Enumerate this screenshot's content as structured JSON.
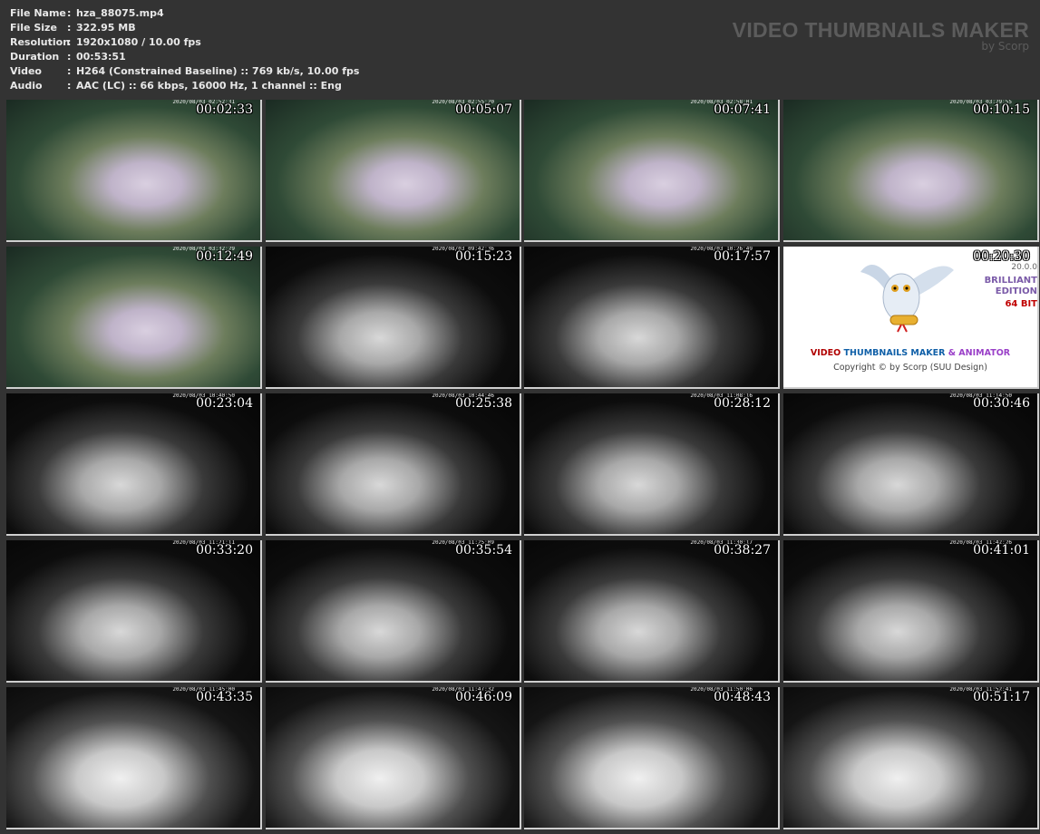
{
  "info": [
    {
      "label": "File Name",
      "value": "hza_88075.mp4"
    },
    {
      "label": "File Size",
      "value": "322.95 MB"
    },
    {
      "label": "Resolution",
      "value": "1920x1080 / 10.00 fps"
    },
    {
      "label": "Duration",
      "value": "00:53:51"
    },
    {
      "label": "Video",
      "value": "H264 (Constrained Baseline) :: 769 kb/s, 10.00 fps"
    },
    {
      "label": "Audio",
      "value": "AAC (LC) :: 66 kbps, 16000 Hz, 1 channel :: Eng"
    }
  ],
  "separator": ":",
  "brand": {
    "title": "VIDEO THUMBNAILS MAKER",
    "subtitle": "by Scorp"
  },
  "logo": {
    "version": "20.0.0",
    "edition_line1": "BRILLIANT",
    "edition_line2": "EDITION",
    "bits": "64 BIT",
    "title_video": "VIDEO",
    "title_thumbs": "THUMBNAILS MAKER",
    "title_anim": "& ANIMATOR",
    "copyright": "Copyright © by Scorp (SUU Design)",
    "colors": {
      "video": "#b00000",
      "thumbs": "#1060a8",
      "anim": "#9a40c8"
    }
  },
  "thumbnails": [
    {
      "time": "00:02:33",
      "cam": "2020/08/03 02:52:31",
      "kind": "color"
    },
    {
      "time": "00:05:07",
      "cam": "2020/08/03 02:55:20",
      "kind": "color"
    },
    {
      "time": "00:07:41",
      "cam": "2020/08/03 02:58:01",
      "kind": "color"
    },
    {
      "time": "00:10:15",
      "cam": "2020/08/03 03:29:55",
      "kind": "color"
    },
    {
      "time": "00:12:49",
      "cam": "2020/08/03 03:32:29",
      "kind": "color"
    },
    {
      "time": "00:15:23",
      "cam": "2020/08/03 09:42:36",
      "kind": "ir"
    },
    {
      "time": "00:17:57",
      "cam": "2020/08/03 10:26:49",
      "kind": "ir"
    },
    {
      "time": "00:20:30",
      "cam": "",
      "kind": "logo"
    },
    {
      "time": "00:23:04",
      "cam": "2020/08/03 10:40:50",
      "kind": "ir"
    },
    {
      "time": "00:25:38",
      "cam": "2020/08/03 10:44:46",
      "kind": "ir"
    },
    {
      "time": "00:28:12",
      "cam": "2020/08/03 11:08:16",
      "kind": "ir"
    },
    {
      "time": "00:30:46",
      "cam": "2020/08/03 11:14:50",
      "kind": "ir"
    },
    {
      "time": "00:33:20",
      "cam": "2020/08/03 11:21:11",
      "kind": "ir"
    },
    {
      "time": "00:35:54",
      "cam": "2020/08/03 11:25:09",
      "kind": "ir"
    },
    {
      "time": "00:38:27",
      "cam": "2020/08/03 11:30:17",
      "kind": "ir"
    },
    {
      "time": "00:41:01",
      "cam": "2020/08/03 11:42:26",
      "kind": "ir"
    },
    {
      "time": "00:43:35",
      "cam": "2020/08/03 11:45:00",
      "kind": "irb"
    },
    {
      "time": "00:46:09",
      "cam": "2020/08/03 11:47:32",
      "kind": "irb"
    },
    {
      "time": "00:48:43",
      "cam": "2020/08/03 11:50:06",
      "kind": "irb"
    },
    {
      "time": "00:51:17",
      "cam": "2020/08/03 11:52:41",
      "kind": "irb"
    }
  ]
}
